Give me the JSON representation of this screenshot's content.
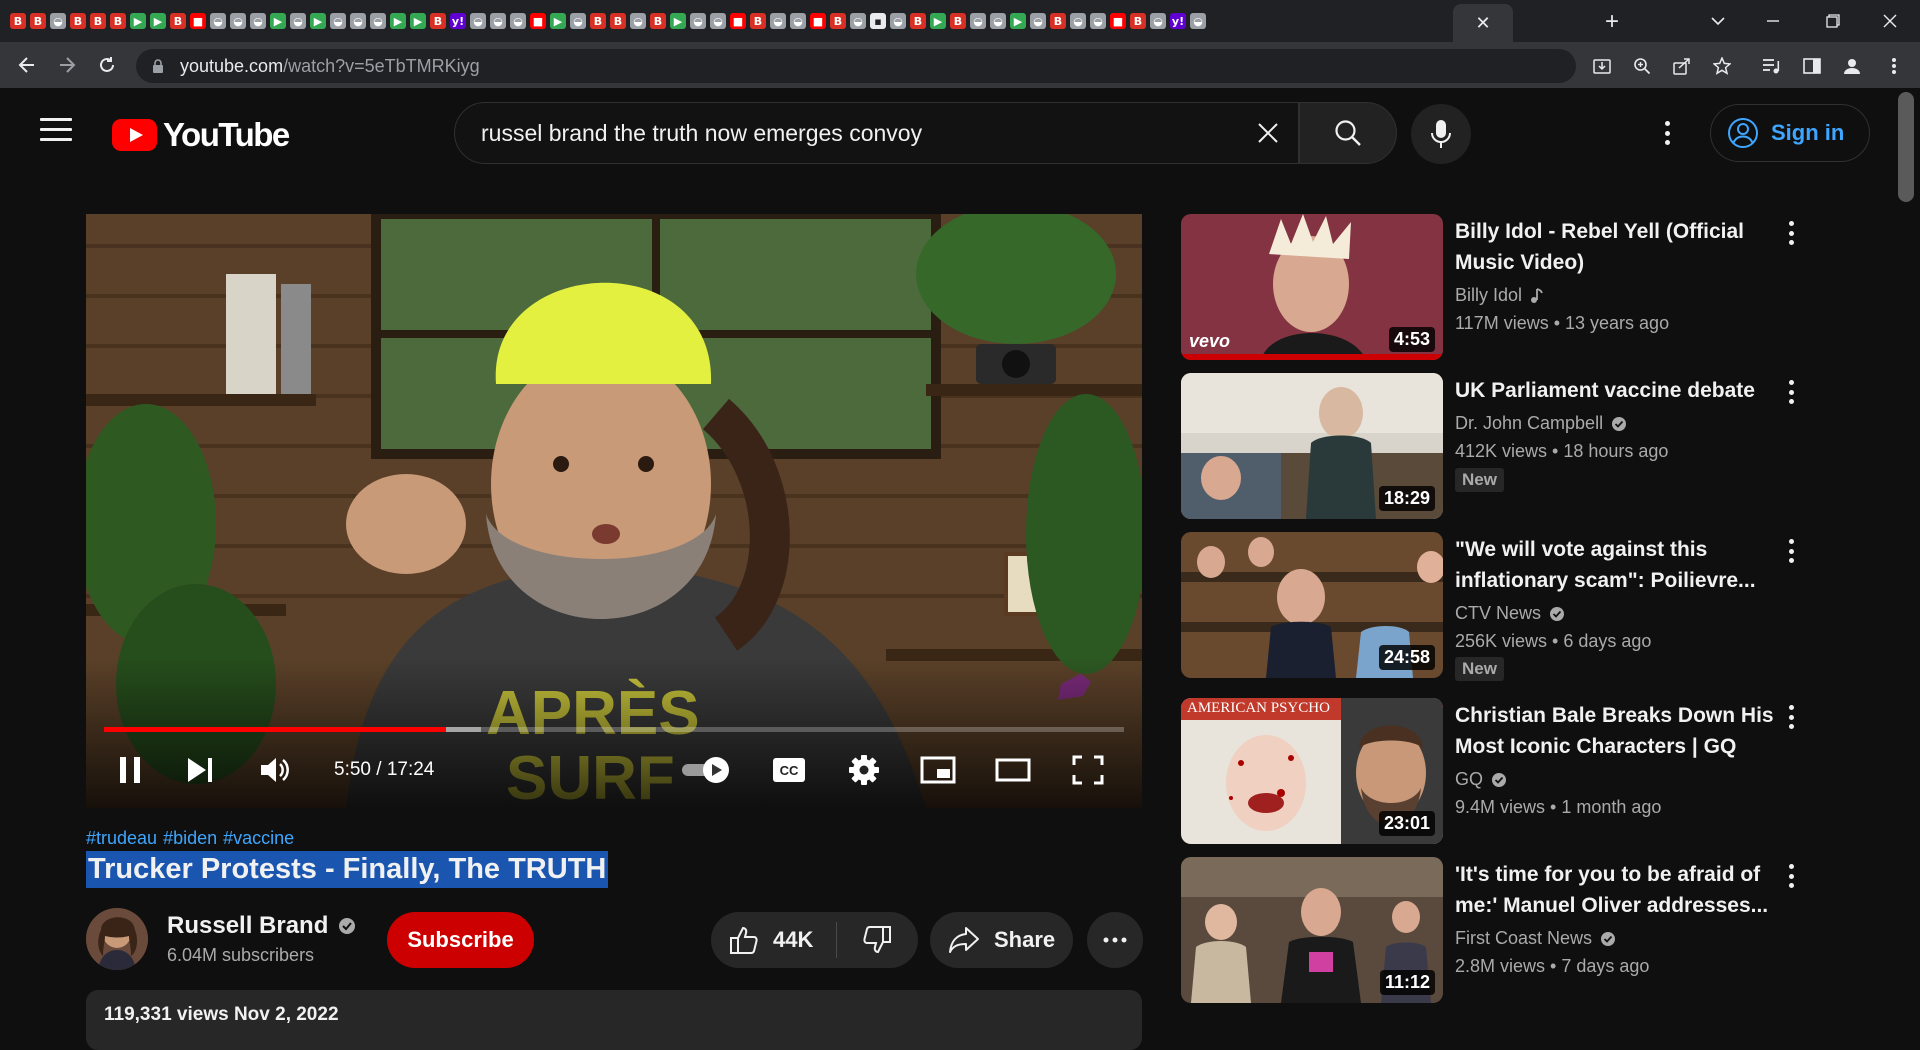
{
  "browser": {
    "tab_favicons": [
      "b",
      "b",
      "g",
      "b",
      "b",
      "b",
      "d",
      "d",
      "b",
      "r",
      "g",
      "g",
      "g",
      "d",
      "g",
      "d",
      "g",
      "g",
      "g",
      "d",
      "d",
      "b",
      "y",
      "g",
      "g",
      "g",
      "r",
      "d",
      "g",
      "b",
      "b",
      "g",
      "b",
      "d",
      "g",
      "g",
      "r",
      "b",
      "g",
      "g",
      "r",
      "b",
      "g",
      "w",
      "g",
      "b",
      "d",
      "b",
      "g",
      "g",
      "d",
      "g",
      "b",
      "g",
      "g",
      "r",
      "b",
      "g",
      "y",
      "g"
    ],
    "active_tab_close": "✕",
    "url_host": "youtube.com",
    "url_path": "/watch?v=5eTbTMRKiyg"
  },
  "masthead": {
    "logo_text": "YouTube",
    "search_value": "russel brand the truth now emerges convoy",
    "signin_label": "Sign in"
  },
  "player": {
    "current_time": "5:50",
    "duration": "17:24",
    "time_display": "5:50 / 17:24",
    "progress_fraction": 0.335,
    "buffered_fraction": 0.37,
    "scene_text": "APRÈS SURF"
  },
  "video": {
    "hashtags": [
      "#trudeau",
      "#biden",
      "#vaccine"
    ],
    "title": "Trucker Protests - Finally, The TRUTH",
    "channel_name": "Russell Brand",
    "subscribers": "6.04M subscribers",
    "subscribe_label": "Subscribe",
    "likes": "44K",
    "share_label": "Share",
    "desc_meta": "119,331 views  Nov 2, 2022"
  },
  "recommendations": [
    {
      "title": "Billy Idol - Rebel Yell (Official Music Video)",
      "channel": "Billy Idol",
      "channel_badge": "music",
      "meta": "117M views  •  13 years ago",
      "duration": "4:53",
      "badge": "",
      "thumb_label": "vevo",
      "thumb_color": "#7a2a3a"
    },
    {
      "title": "UK Parliament vaccine debate",
      "channel": "Dr. John Campbell",
      "channel_badge": "verified",
      "meta": "412K views  •  18 hours ago",
      "duration": "18:29",
      "badge": "New",
      "thumb_label": "",
      "thumb_color": "#6a6a62"
    },
    {
      "title": "\"We will vote against this inflationary scam\": Poilievre...",
      "channel": "CTV News",
      "channel_badge": "verified",
      "meta": "256K views  •  6 days ago",
      "duration": "24:58",
      "badge": "New",
      "thumb_label": "",
      "thumb_color": "#5a3a28"
    },
    {
      "title": "Christian Bale Breaks Down His Most Iconic Characters | GQ",
      "channel": "GQ",
      "channel_badge": "verified",
      "meta": "9.4M views  •  1 month ago",
      "duration": "23:01",
      "badge": "",
      "thumb_label": "AMERICAN PSYCHO",
      "thumb_color": "#e8e4dc"
    },
    {
      "title": "'It's time for you to be afraid of me:' Manuel Oliver addresses...",
      "channel": "First Coast News",
      "channel_badge": "verified",
      "meta": "2.8M views  •  7 days ago",
      "duration": "11:12",
      "badge": "",
      "thumb_label": "",
      "thumb_color": "#4a3a30"
    }
  ],
  "colors": {
    "accent_red": "#ff0000",
    "subscribe_red": "#cc0000",
    "link_blue": "#3ea6ff",
    "selection_blue": "#1a56b0",
    "bg": "#0f0f0f"
  }
}
